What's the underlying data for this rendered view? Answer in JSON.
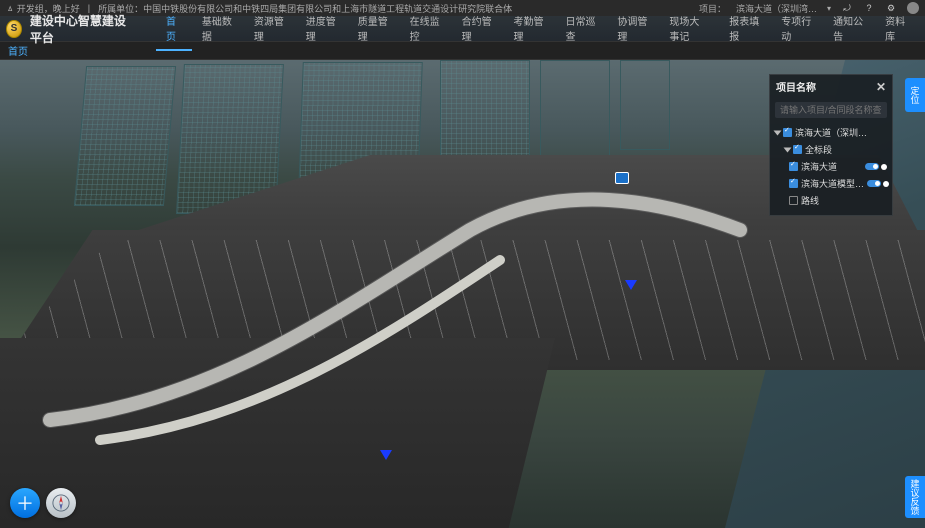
{
  "topbar": {
    "greeting": "ㅿ 开发组，晚上好",
    "org": "所属单位：中国中铁股份有限公司和中铁四局集团有限公司和上海市隧道工程轨道交通设计研究院联合体",
    "project_label": "项目：",
    "project_value": "滨海大道（深圳湾…"
  },
  "header": {
    "app_title": "建设中心智慧建设平台",
    "nav": [
      {
        "label": "首页",
        "active": true
      },
      {
        "label": "基础数据",
        "active": false
      },
      {
        "label": "资源管理",
        "active": false
      },
      {
        "label": "进度管理",
        "active": false
      },
      {
        "label": "质量管理",
        "active": false
      },
      {
        "label": "在线监控",
        "active": false
      },
      {
        "label": "合约管理",
        "active": false
      },
      {
        "label": "考勤管理",
        "active": false
      },
      {
        "label": "日常巡查",
        "active": false
      },
      {
        "label": "协调管理",
        "active": false
      },
      {
        "label": "现场大事记",
        "active": false
      },
      {
        "label": "报表填报",
        "active": false
      },
      {
        "label": "专项行动",
        "active": false
      },
      {
        "label": "通知公告",
        "active": false
      },
      {
        "label": "资料库",
        "active": false
      }
    ]
  },
  "breadcrumb": {
    "root": "首页"
  },
  "panel": {
    "title": "项目名称",
    "search_placeholder": "请输入项目/合同段名称查询",
    "tree": {
      "root": {
        "label": "滨海大道（深圳湾总部基地段…",
        "checked": true
      },
      "group": {
        "label": "全标段",
        "checked": true
      },
      "item1": {
        "label": "滨海大道",
        "checked": true
      },
      "item2": {
        "label": "滨海大道模型…",
        "checked": true
      },
      "item3": {
        "label": "路线",
        "checked": false
      }
    }
  },
  "side_tab_top": "定位",
  "side_tab_bottom": "建议反馈"
}
